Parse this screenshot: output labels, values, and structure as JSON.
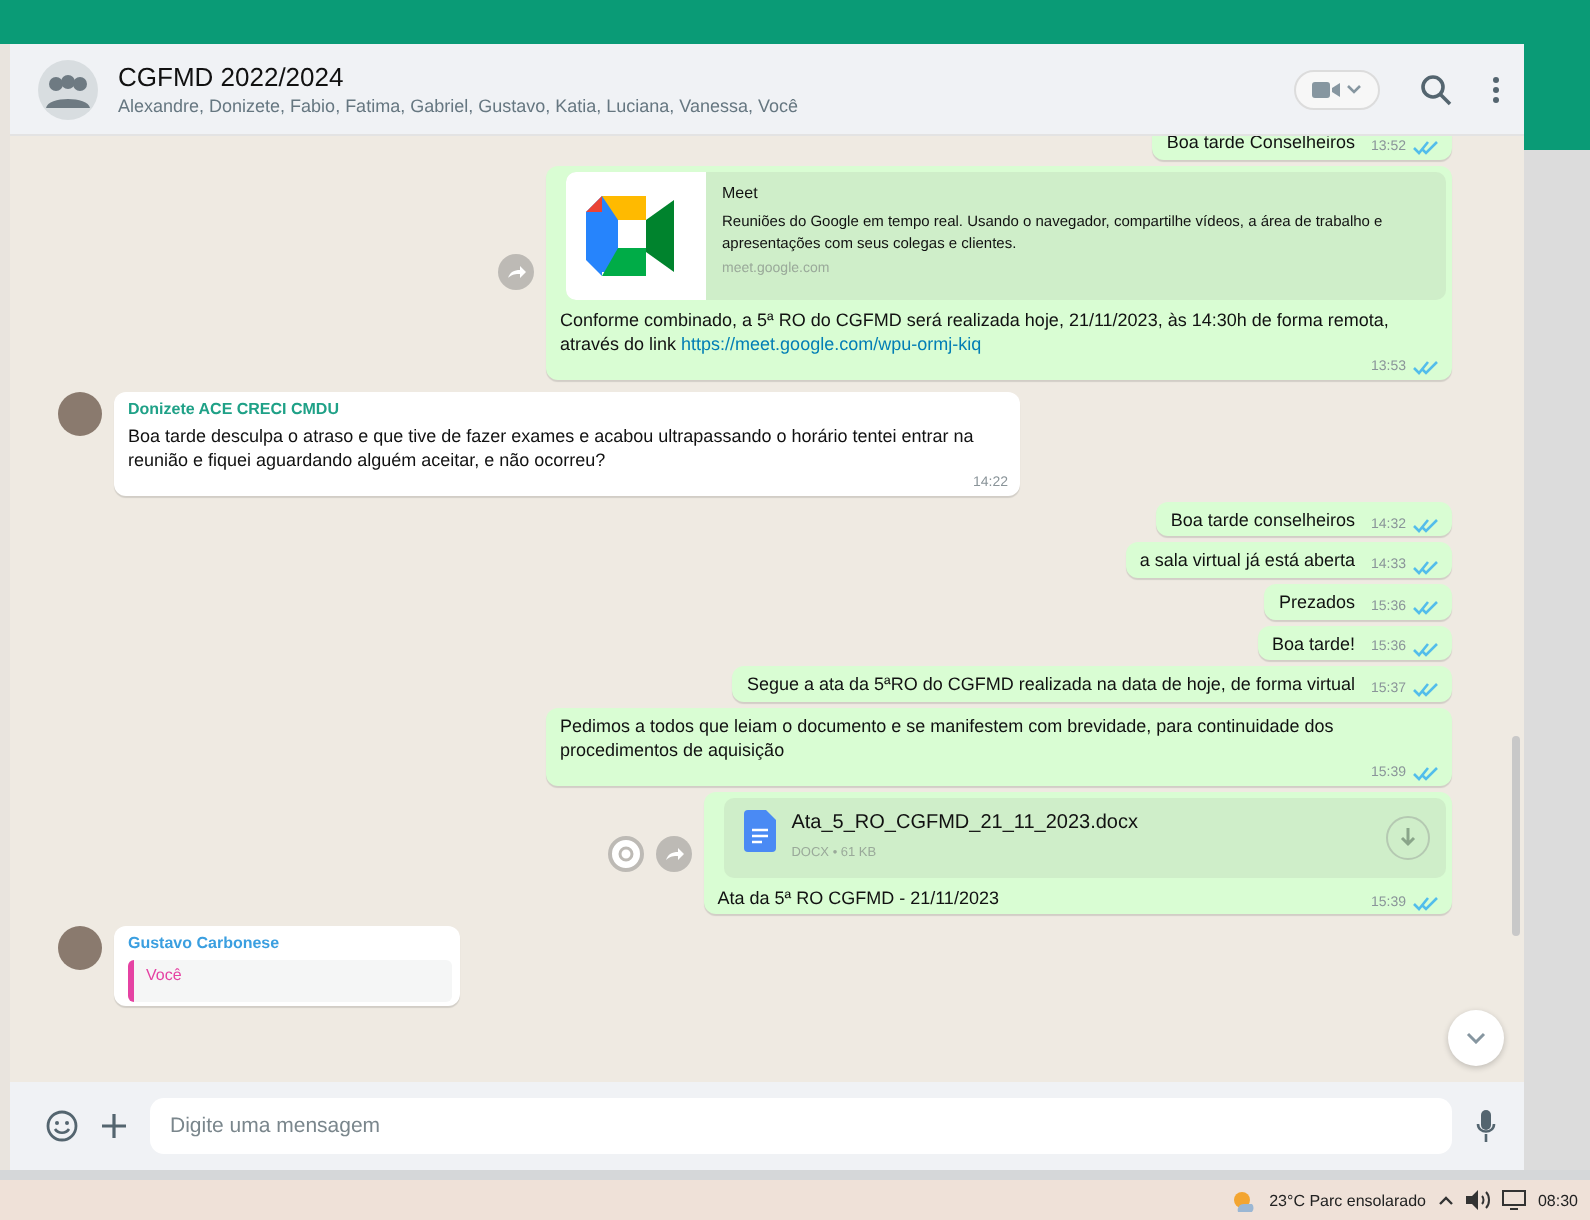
{
  "chat_header": {
    "title": "CGFMD 2022/2024",
    "members": "Alexandre, Donizete, Fabio, Fatima, Gabriel, Gustavo, Katia, Luciana, Vanessa, Você"
  },
  "messages": [
    {
      "kind": "sent_text",
      "text": "Boa tarde Conselheiros",
      "time": "13:52",
      "read": true
    },
    {
      "kind": "sent_link",
      "preview_title": "Meet",
      "preview_description": "Reuniões do Google em tempo real. Usando o navegador, compartilhe vídeos, a área de trabalho e apresentações com seus colegas e clientes.",
      "preview_domain": "meet.google.com",
      "text": "Conforme combinado, a 5ª RO do CGFMD será realizada hoje, 21/11/2023, às 14:30h de forma remota, através do link",
      "link": "https://meet.google.com/wpu-ormj-kiq",
      "time": "13:53",
      "read": true
    },
    {
      "kind": "received_text",
      "sender": "Donizete ACE CRECI CMDU",
      "color": "#1fa187",
      "text": "Boa tarde desculpa o atraso e que tive de fazer exames e acabou ultrapassando o horário tentei entrar na reunião e fiquei aguardando alguém aceitar, e não ocorreu?",
      "time": "14:22"
    },
    {
      "kind": "sent_text",
      "text": "Boa tarde conselheiros",
      "time": "14:32",
      "read": true
    },
    {
      "kind": "sent_text",
      "text": "a sala virtual já está aberta",
      "time": "14:33",
      "read": true
    },
    {
      "kind": "sent_text",
      "text": "Prezados",
      "time": "15:36",
      "read": true
    },
    {
      "kind": "sent_text",
      "text": "Boa tarde!",
      "time": "15:36",
      "read": true
    },
    {
      "kind": "sent_text",
      "text": "Segue a ata da 5ªRO do CGFMD realizada na data de hoje, de forma virtual",
      "time": "15:37",
      "read": true
    },
    {
      "kind": "sent_text",
      "text": "Pedimos a todos que leiam o documento e se manifestem com brevidade, para continuidade dos procedimentos de aquisição",
      "time": "15:39",
      "read": true
    },
    {
      "kind": "sent_document",
      "file_name": "Ata_5_RO_CGFMD_21_11_2023.docx",
      "file_info": "DOCX • 61 KB",
      "text": "Ata da 5ª RO CGFMD - 21/11/2023",
      "time": "15:39",
      "read": true
    },
    {
      "kind": "received_quote",
      "sender": "Gustavo Carbonese",
      "color": "#3b9fe0",
      "quoted_author": "Você"
    }
  ],
  "composer": {
    "placeholder": "Digite uma mensagem"
  },
  "taskbar": {
    "weather": "23°C  Parc ensolarado",
    "time": "08:30"
  }
}
